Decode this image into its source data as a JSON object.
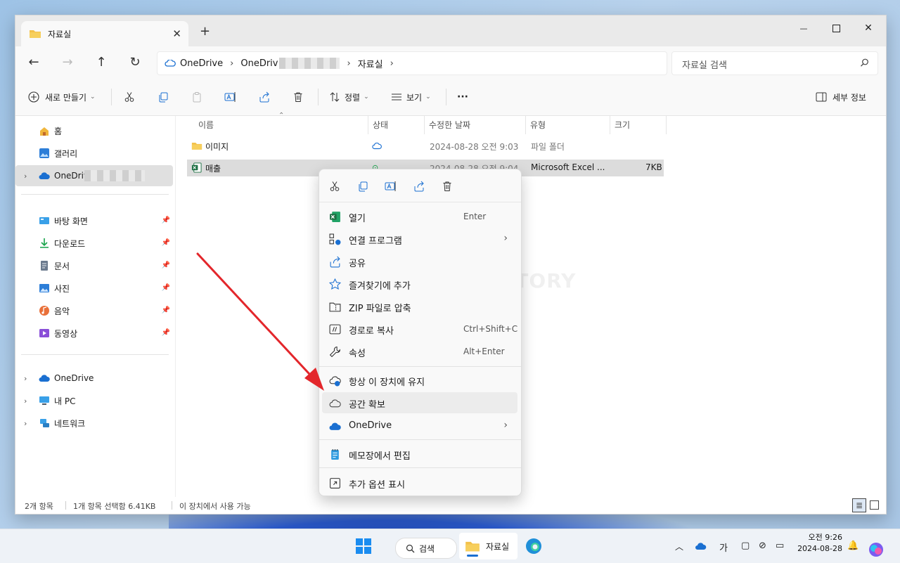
{
  "window": {
    "tab_title": "자료실",
    "new_tab_label": "+",
    "minimize_label": "—",
    "close_label": "✕"
  },
  "breadcrumb": {
    "items": [
      "OneDrive",
      "OneDriv",
      "자료실"
    ],
    "separator": "›"
  },
  "search": {
    "placeholder": "자료실 검색"
  },
  "toolbar": {
    "new_label": "새로 만들기",
    "sort_label": "정렬",
    "view_label": "보기",
    "more_label": "···",
    "details_label": "세부 정보"
  },
  "sidebar": {
    "home": "홈",
    "gallery": "갤러리",
    "onedrive_personal": "OneDriv",
    "quick_access": [
      "바탕 화면",
      "다운로드",
      "문서",
      "사진",
      "음악",
      "동영상"
    ],
    "onedrive": "OneDrive",
    "this_pc": "내 PC",
    "network": "네트워크"
  },
  "columns": [
    "이름",
    "상태",
    "수정한 날짜",
    "유형",
    "크기"
  ],
  "files": [
    {
      "name": "이미지",
      "modified": "2024-08-28 오전 9:03",
      "type": "파일 폴더",
      "size": ""
    },
    {
      "name": "매출",
      "modified": "2024-08-28 오전 9:04",
      "type": "Microsoft Excel ...",
      "size": "7KB"
    }
  ],
  "context_menu": {
    "items": [
      {
        "label": "열기",
        "shortcut": "Enter"
      },
      {
        "label": "연결 프로그램",
        "shortcut": ""
      },
      {
        "label": "공유",
        "shortcut": ""
      },
      {
        "label": "즐겨찾기에 추가",
        "shortcut": ""
      },
      {
        "label": "ZIP 파일로 압축",
        "shortcut": ""
      },
      {
        "label": "경로로 복사",
        "shortcut": "Ctrl+Shift+C"
      },
      {
        "label": "속성",
        "shortcut": "Alt+Enter"
      },
      {
        "label": "항상 이 장치에 유지",
        "shortcut": ""
      },
      {
        "label": "공간 확보",
        "shortcut": ""
      },
      {
        "label": "OneDrive",
        "shortcut": ""
      },
      {
        "label": "메모장에서 편집",
        "shortcut": ""
      },
      {
        "label": "추가 옵션 표시",
        "shortcut": ""
      }
    ]
  },
  "watermark": "MANUAL FACTORY",
  "statusbar": {
    "count": "2개 항목",
    "selected": "1개 항목 선택함 6.41KB",
    "availability": "이 장치에서 사용 가능"
  },
  "taskbar": {
    "search_label": "검색",
    "explorer_label": "자료실",
    "ime_label": "가",
    "time": "오전 9:26",
    "date": "2024-08-28"
  },
  "colors": {
    "accent": "#1a6fd1",
    "annotation_arrow": "#e3262b",
    "folder": "#f3c14b",
    "excel": "#1d7044"
  }
}
